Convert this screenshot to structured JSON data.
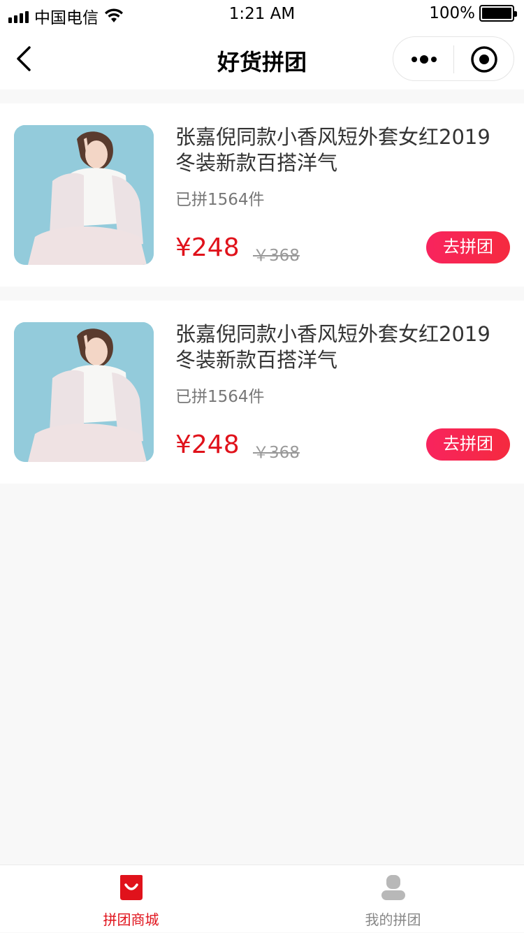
{
  "status_bar": {
    "carrier": "中国电信",
    "time": "1:21 AM",
    "battery": "100%"
  },
  "nav": {
    "title": "好货拼团"
  },
  "products": [
    {
      "title_line1": "张嘉倪同款小香风短外套女红2019",
      "title_line2": "冬装新款百搭洋气",
      "sold": "已拼1564件",
      "price": "¥248",
      "old_price": "￥368",
      "button": "去拼团"
    },
    {
      "title_line1": "张嘉倪同款小香风短外套女红2019",
      "title_line2": "冬装新款百搭洋气",
      "sold": "已拼1564件",
      "price": "¥248",
      "old_price": "￥368",
      "button": "去拼团"
    }
  ],
  "tabbar": {
    "tabs": [
      {
        "label": "拼团商城",
        "icon": "shopping-bag-icon",
        "active": true
      },
      {
        "label": "我的拼团",
        "icon": "user-icon",
        "active": false
      }
    ]
  },
  "colors": {
    "accent": "#e0121b",
    "button": "#f8245e",
    "inactive": "#999999"
  }
}
